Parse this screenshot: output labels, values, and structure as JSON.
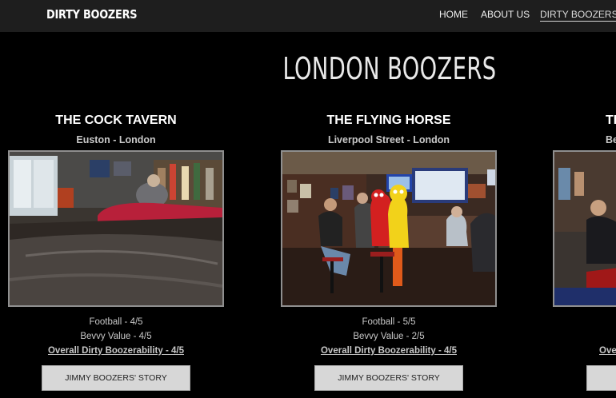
{
  "header": {
    "brand": "DIRTY BOOZERS",
    "nav": [
      {
        "label": "HOME",
        "active": false
      },
      {
        "label": "ABOUT US",
        "active": false
      },
      {
        "label": "DIRTY BOOZERS",
        "active": true
      }
    ]
  },
  "main": {
    "title": "LONDON BOOZERS",
    "pubs": [
      {
        "name": "THE COCK TAVERN",
        "location": "Euston - London",
        "football": "Football - 4/5",
        "bevvy": "Bevvy Value - 4/5",
        "overall": "Overall Dirty Boozerability - 4/5",
        "button": "JIMMY BOOZERS' STORY"
      },
      {
        "name": "THE FLYING HORSE",
        "location": "Liverpool Street - London",
        "football": "Football - 5/5",
        "bevvy": "Bevvy Value - 2/5",
        "overall": "Overall Dirty Boozerability - 4/5",
        "button": "JIMMY BOOZERS' STORY"
      },
      {
        "name": "TH",
        "location": "Be",
        "overall": "Overa"
      }
    ]
  },
  "colors": {
    "background": "#000000",
    "topbar": "#1e1e1e",
    "button": "#d7d7d7",
    "photo_border": "#8f8f8f"
  }
}
